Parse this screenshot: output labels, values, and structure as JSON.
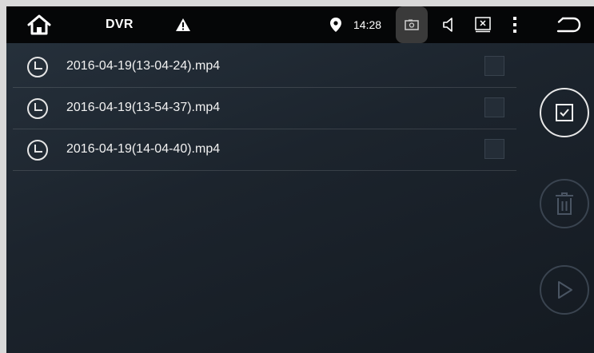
{
  "status_bar": {
    "title": "DVR",
    "time": "14:28",
    "icons": {
      "home": "home-icon",
      "warning": "warning-icon",
      "location": "location-pin-icon",
      "screenshot": "screenshot-icon",
      "volume": "volume-icon",
      "close_app": "close-app-icon",
      "menu": "more-vert-icon",
      "back": "back-icon"
    }
  },
  "files": [
    {
      "name": "2016-04-19(13-04-24).mp4",
      "checked": false
    },
    {
      "name": "2016-04-19(13-54-37).mp4",
      "checked": false
    },
    {
      "name": "2016-04-19(14-04-40).mp4",
      "checked": false
    }
  ],
  "side_actions": {
    "select_all": {
      "icon": "checkbox-icon",
      "enabled": true
    },
    "delete": {
      "icon": "trash-icon",
      "enabled": false
    },
    "play": {
      "icon": "play-icon",
      "enabled": false
    }
  },
  "colors": {
    "status_bar_bg": "#050607",
    "background_top": "#27323d",
    "background_bottom": "#141a21",
    "active_control": "#e8e8e8",
    "disabled_control": "#3a4450"
  }
}
